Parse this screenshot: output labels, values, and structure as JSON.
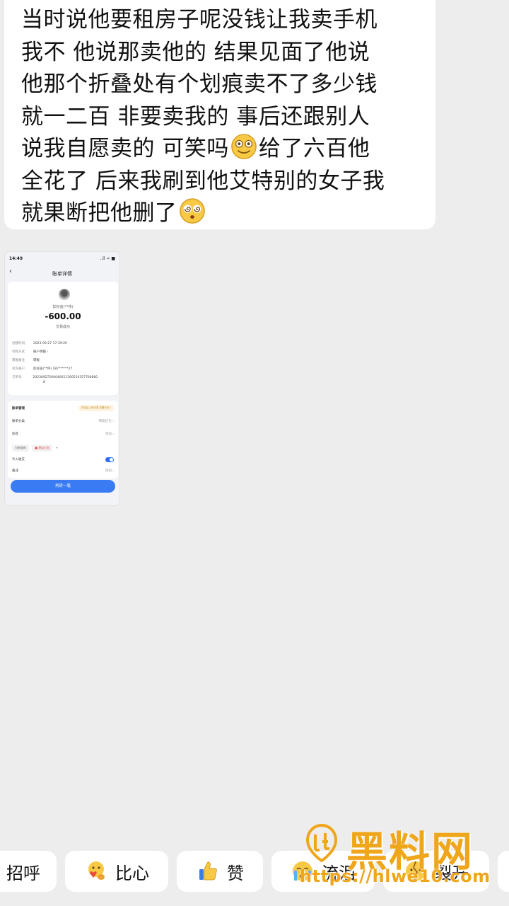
{
  "message": {
    "lines": [
      "当时说他要租房子呢没钱让我卖手机",
      "我不 他说那卖他的 结果见面了他说",
      "他那个折叠处有个划痕卖不了多少钱",
      "就一二百 非要卖我的 事后还跟别人",
      "说我自愿卖的 可笑吗",
      "给了六百他",
      "全花了 后来我刷到他艾特别的女子我",
      "就果断把他删了"
    ],
    "emoji_1": "smile-emoji",
    "emoji_2": "dizzy-emoji"
  },
  "bill": {
    "status_time": "14:49",
    "status_icons": "..ll ≈ ■",
    "back": "‹",
    "title": "账单详情",
    "name": "彭好迪(**伟)",
    "amount": "-600.00",
    "status": "交易成功",
    "rows": [
      {
        "label": "创建时间",
        "value": "2023-09-27 17:39:29"
      },
      {
        "label": "付款方式",
        "value": "账户余额 ›"
      },
      {
        "label": "转账备注",
        "value": "转账"
      },
      {
        "label": "对方账户",
        "value": "彭好迪(**伟) 187******27"
      },
      {
        "label": "订单号",
        "value": "20230927200040011300510357708880"
      },
      {
        "label": "",
        "value": "8"
      }
    ],
    "mgmt_title": "账单管理",
    "mgmt_pill": "开启后上传记录 查看计划 ›",
    "category_label": "账单分类",
    "category_value": "转账红包 ›",
    "tag_label": "标签",
    "tag_value": "添加 ›",
    "tags": [
      "为他花的",
      "■ 朋友红包",
      "+"
    ],
    "income_label": "计入收支",
    "note_label": "备注",
    "note_value": "添加 ›",
    "button": "再转一笔"
  },
  "reactions": [
    {
      "label": "招呼",
      "icon": ""
    },
    {
      "label": "比心",
      "icon": "heart-hands-icon"
    },
    {
      "label": "赞",
      "icon": "thumbs-up-icon"
    },
    {
      "label": "流泪",
      "icon": "crying-face-icon"
    },
    {
      "label": "裂开",
      "icon": "cracked-face-icon"
    },
    {
      "label": "",
      "icon": ""
    }
  ],
  "watermark": {
    "text": "黑料网",
    "url": "https://hlwe10.com"
  },
  "colors": {
    "background": "#ededed",
    "accent_blue": "#3a7bf4",
    "watermark": "#f0a61a"
  }
}
